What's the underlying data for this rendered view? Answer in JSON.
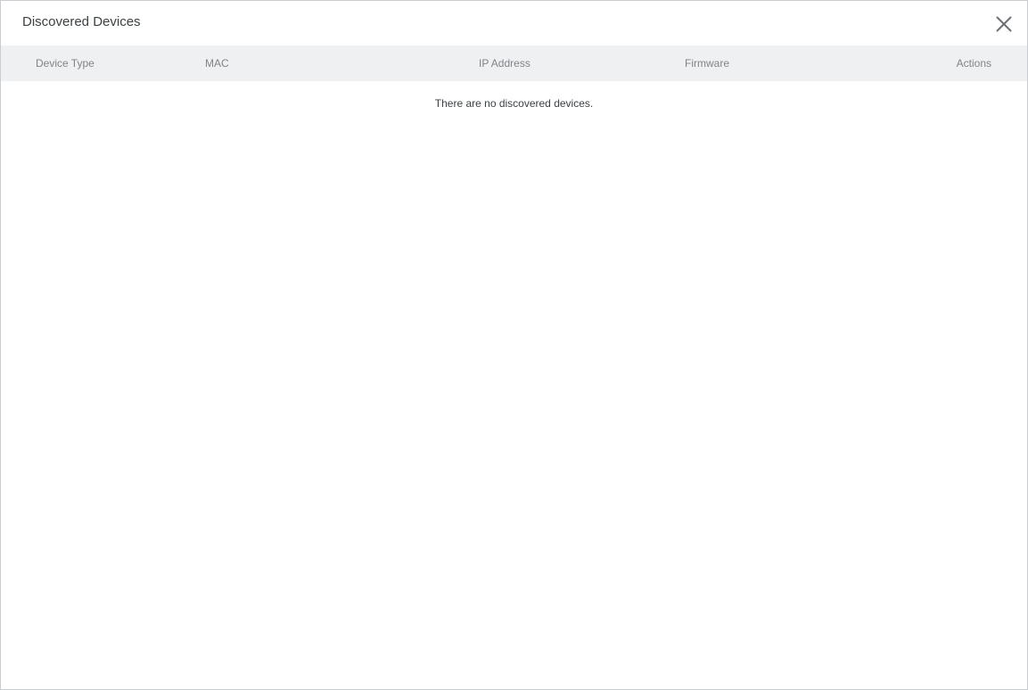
{
  "dialog": {
    "title": "Discovered Devices",
    "close_icon": "close-icon"
  },
  "table": {
    "columns": [
      "Device Type",
      "MAC",
      "IP Address",
      "Firmware",
      "Actions"
    ],
    "rows": [],
    "empty_message": "There are no discovered devices."
  },
  "colors": {
    "header_background": "#eef0f2",
    "title_text": "#3c4144",
    "column_text": "#808489",
    "border": "#c9ccd1"
  }
}
